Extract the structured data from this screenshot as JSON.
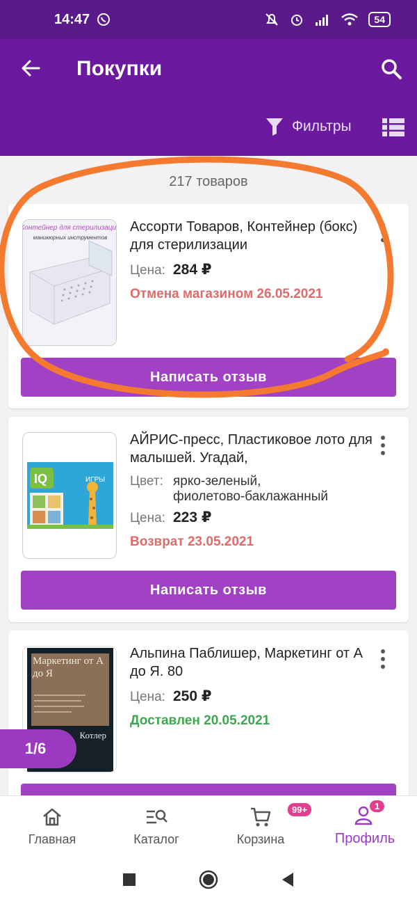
{
  "status_bar": {
    "time": "14:47",
    "battery": "54"
  },
  "header": {
    "title": "Покупки",
    "filters_label": "Фильтры"
  },
  "items_count": "217 товаров",
  "price_label": "Цена:",
  "color_label": "Цвет:",
  "review_button_label": "Написать отзыв",
  "cards": [
    {
      "name": "Ассорти Товаров, Контейнер (бокс) для стерилизации",
      "price": "284 ₽",
      "status": "Отмена магазином 26.05.2021",
      "thumb_title": "Контейнер для стерилизации",
      "thumb_subtitle": "маникюрных инструментов"
    },
    {
      "name": "АЙРИС-пресс, Пластиковое лото для малышей. Угадай,",
      "color_line1": "ярко-зеленый,",
      "color_line2": "фиолетово-баклажанный",
      "price": "223 ₽",
      "status": "Возврат 23.05.2021",
      "thumb_text1": "IQ",
      "thumb_text2": "ИГРЫ"
    },
    {
      "name": "Альпина Паблишер, Маркетинг от А до Я. 80",
      "price": "250 ₽",
      "status": "Доставлен 20.05.2021",
      "book_title": "Маркетинг от А до Я",
      "book_author": "Котлер"
    }
  ],
  "pager": "1/6",
  "bottom_nav": [
    {
      "label": "Главная",
      "icon": "home-icon"
    },
    {
      "label": "Каталог",
      "icon": "catalog-search-icon"
    },
    {
      "label": "Корзина",
      "icon": "cart-icon",
      "badge": "99+"
    },
    {
      "label": "Профиль",
      "icon": "profile-icon",
      "badge": "1",
      "active": true
    }
  ],
  "colors": {
    "appbar": "#6b1aa0",
    "button": "#a141c3",
    "accent": "#9b3ac8",
    "annotation": "#f47a30"
  }
}
